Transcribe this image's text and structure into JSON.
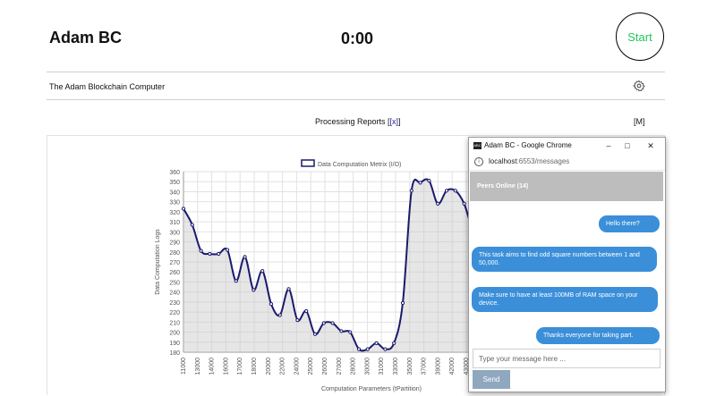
{
  "header": {
    "app_title": "Adam BC",
    "timer": "0:00",
    "start_label": "Start"
  },
  "subheader": {
    "subtitle": "The Adam Blockchain Computer",
    "settings_icon": "gear-icon"
  },
  "section": {
    "title_prefix": "Processing Reports [",
    "title_link": "[x]",
    "title_suffix": "]",
    "m_link": "[M]"
  },
  "chart_data": {
    "type": "line",
    "legend": [
      "Data Computation Metrix (I/O)"
    ],
    "xlabel": "Computation Parameters (tPartition)",
    "ylabel": "Data Computation Logs",
    "ylim": [
      180,
      360
    ],
    "yticks": [
      180,
      190,
      200,
      210,
      220,
      230,
      240,
      250,
      260,
      270,
      280,
      290,
      300,
      310,
      320,
      330,
      340,
      350,
      360
    ],
    "xticks": [
      "11000",
      "13000",
      "14000",
      "16000",
      "17000",
      "18000",
      "20000",
      "22000",
      "24000",
      "25000",
      "26000",
      "27000",
      "28000",
      "30000",
      "31000",
      "33000",
      "35000",
      "37000",
      "39000",
      "42000",
      "43000"
    ],
    "grid": true,
    "series": [
      {
        "name": "Data Computation Metrix (I/O)",
        "color": "#1a1a6e",
        "values": [
          323,
          307,
          281,
          278,
          278,
          282,
          251,
          275,
          242,
          261,
          228,
          217,
          243,
          212,
          221,
          198,
          209,
          209,
          201,
          200,
          183,
          183,
          189,
          183,
          189,
          229,
          341,
          349,
          351,
          328,
          341,
          341,
          328,
          302,
          299,
          300
        ]
      }
    ]
  },
  "popup": {
    "window_title": "Adam BC - Google Chrome",
    "favicon_text": "ABC",
    "url_host": "localhost",
    "url_path": ":6553/messages",
    "peers": "Peers Online (14)",
    "messages": [
      "Hello there?",
      "This task aims to find odd square numbers between 1 and 50,000.",
      "Make sure to have at least 100MB of RAM space on your device.",
      "Thanks everyone for taking part."
    ],
    "input_placeholder": "Type your message here ...",
    "send_label": "Send"
  }
}
